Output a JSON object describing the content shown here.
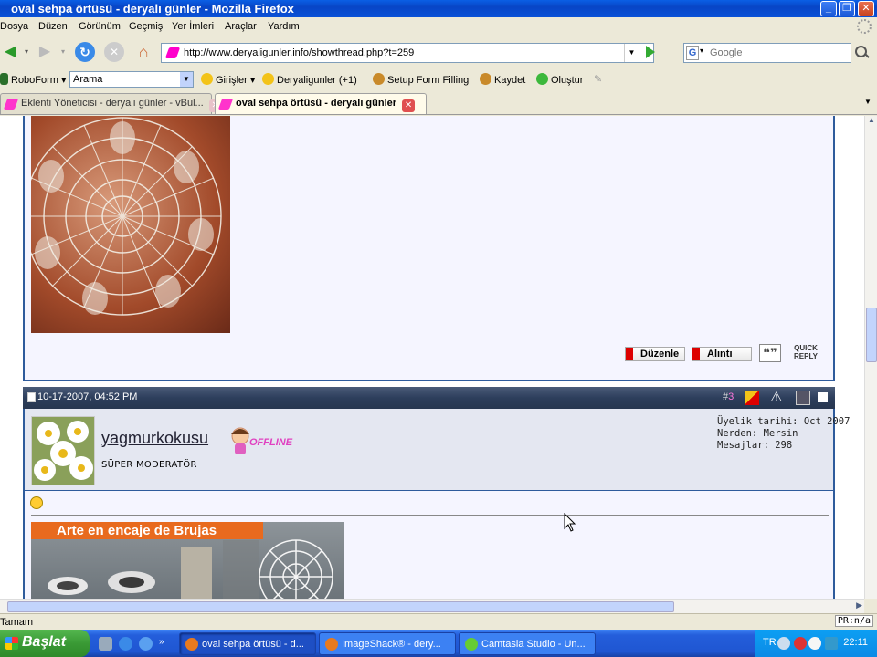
{
  "window": {
    "title": "oval sehpa örtüsü - deryalı günler - Mozilla Firefox"
  },
  "menu": {
    "items": [
      "Dosya",
      "Düzen",
      "Görünüm",
      "Geçmiş",
      "Yer İmleri",
      "Araçlar",
      "Yardım"
    ]
  },
  "nav": {
    "url": "http://www.deryaligunler.info/showthread.php?t=259",
    "search_placeholder": "Google"
  },
  "toolbar": {
    "roboform_label": "RoboForm",
    "arama_value": "Arama",
    "girisler_label": "Girişler",
    "deryaligunler_label": "Deryaligunler (+1)",
    "setup_form_label": "Setup Form Filling",
    "kaydet_label": "Kaydet",
    "olustur_label": "Oluştur"
  },
  "tabs": [
    {
      "label": "Eklenti Yöneticisi - deryalı günler - vBul...",
      "active": false
    },
    {
      "label": "oval sehpa örtüsü - deryalı günler",
      "active": true
    }
  ],
  "post1": {
    "edit_label": "Düzenle",
    "quote_label": "Alıntı",
    "quick_reply_label": "QUICK REPLY"
  },
  "post2": {
    "date": "10-17-2007, 04:52 PM",
    "post_number_prefix": "#",
    "post_number": "3",
    "username": "yagmurkokusu",
    "offline_label": "OFFLINE",
    "role": "SÜPER MODERATÖR",
    "join_date": "Üyelik tarihi: Oct 2007",
    "location": "Nerden: Mersin",
    "posts": "Mesajlar: 298",
    "image_banner": "Arte en encaje de Brujas"
  },
  "status": {
    "text": "Tamam",
    "right": "PR:n/a"
  },
  "taskbar": {
    "start_label": "Başlat",
    "items": [
      {
        "label": "oval sehpa örtüsü - d...",
        "active": true
      },
      {
        "label": "ImageShack® - dery...",
        "active": false
      },
      {
        "label": "Camtasia Studio - Un...",
        "active": false
      }
    ],
    "lang": "TR",
    "clock": "22:11"
  },
  "colors": {
    "post_border": "#2e5b9c",
    "header_bar": "#2d3e5c",
    "taskbar": "#245edb",
    "start_green": "#3a9a35"
  }
}
